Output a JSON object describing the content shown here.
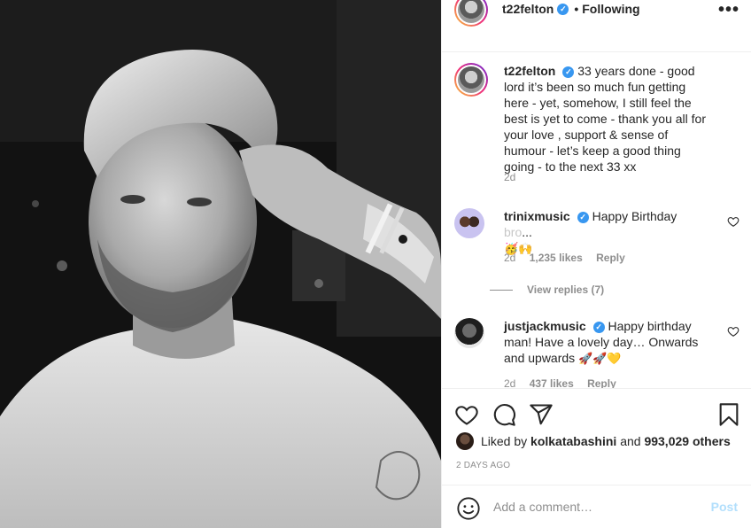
{
  "post": {
    "image_alt": "black and white portrait photo",
    "author": "t22felton",
    "follow_state": "Following",
    "more_label": "•••"
  },
  "caption": {
    "username": "t22felton",
    "text": "33 years done - good lord it’s been so much fun getting here - yet, somehow, I still feel the best is yet to come - thank you all for your love , support & sense of humour - let’s keep a good thing going - to the next 33 xx",
    "time": "2d"
  },
  "comments": [
    {
      "username": "trinixmusic",
      "text": "Happy Birthday",
      "text_faded": "bro",
      "text_more": "...",
      "emoji": "🥳🙌",
      "time": "2d",
      "likes": "1,235 likes",
      "reply": "Reply",
      "view_replies": "View replies (7)"
    },
    {
      "username": "justjackmusic",
      "text": "Happy birthday man! Have a lovely day… Onwards and upwards",
      "emoji": "🚀🚀💛",
      "time": "2d",
      "likes": "437 likes",
      "reply": "Reply"
    }
  ],
  "likes": {
    "prefix": "Liked by",
    "user": "kolkatabashini",
    "and": "and",
    "others": "993,029 others"
  },
  "date": "2 DAYS AGO",
  "add_comment": {
    "placeholder": "Add a comment…",
    "post_label": "Post"
  },
  "icons": {
    "like": "heart-icon",
    "comment": "comment-icon",
    "share": "paper-plane-icon",
    "save": "bookmark-icon",
    "emoji": "emoji-icon",
    "verified": "verified-badge-icon"
  },
  "colors": {
    "verified": "#3897f0",
    "post_button": "#b2dffc",
    "muted": "#8e8e8e"
  }
}
